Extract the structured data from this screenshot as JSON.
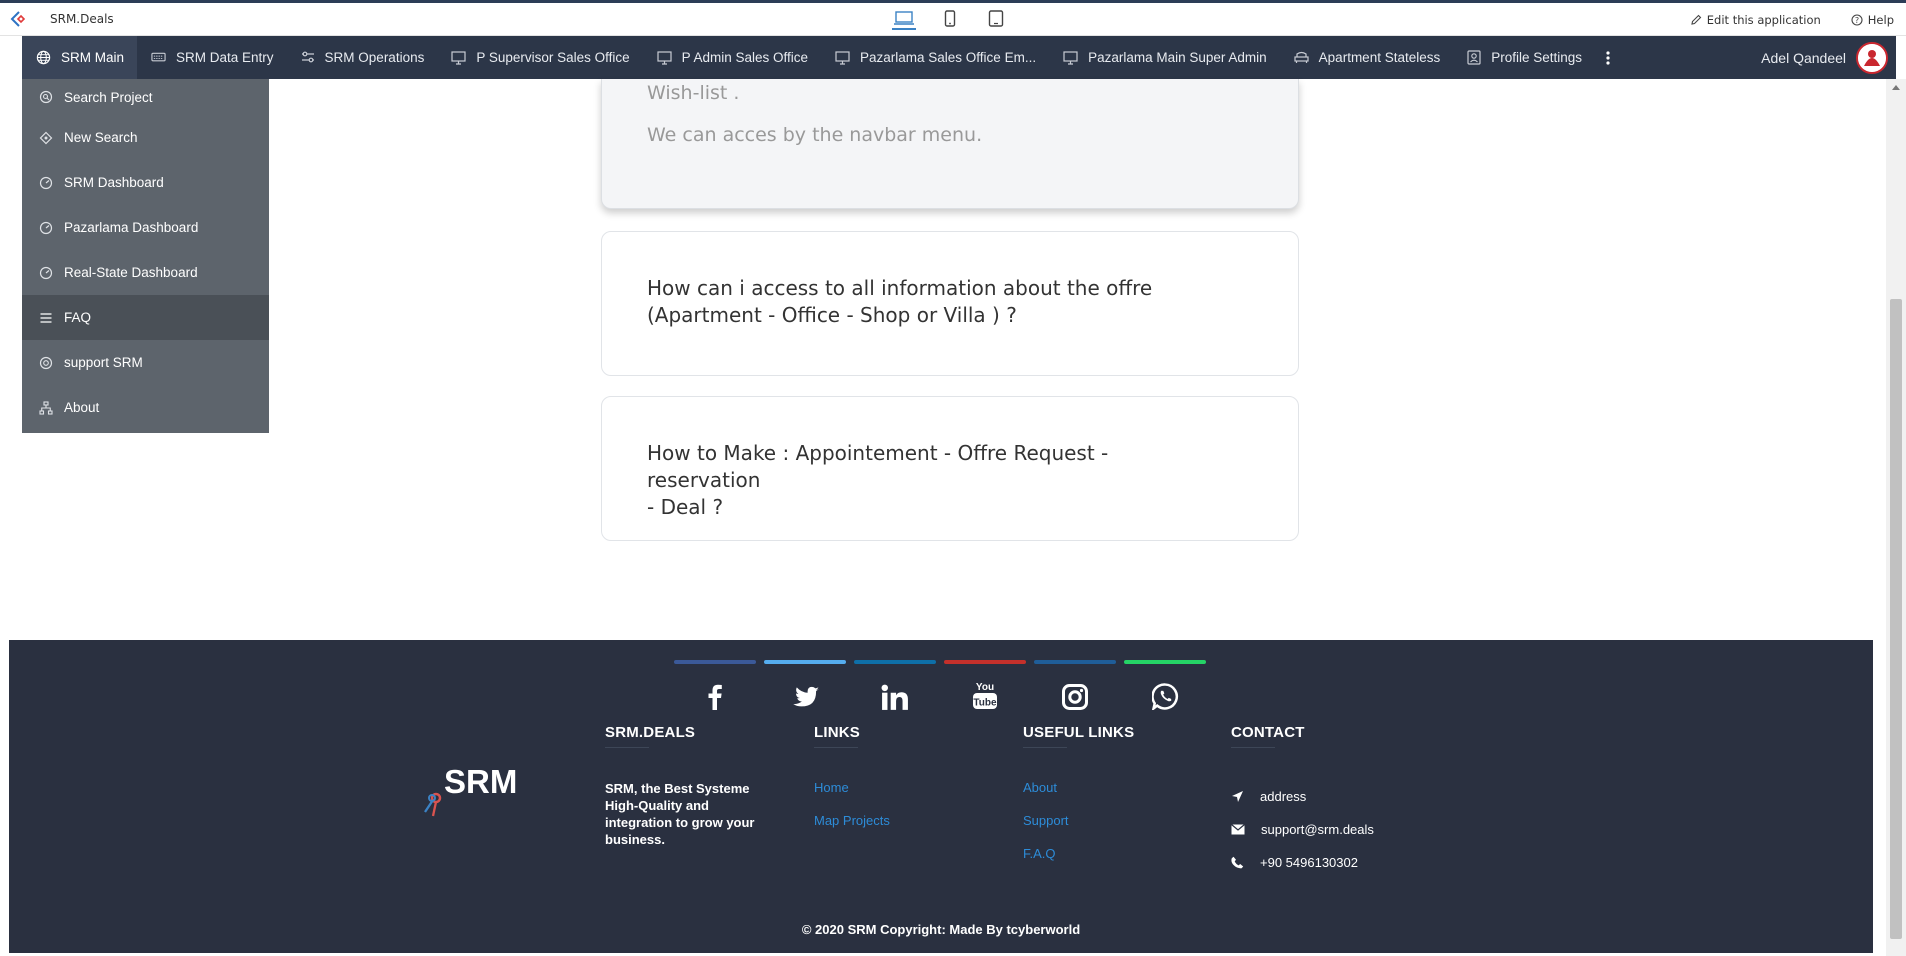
{
  "appbar": {
    "title": "SRM.Deals",
    "edit_label": "Edit this application",
    "help_label": "Help"
  },
  "navbar": {
    "items": [
      {
        "label": "SRM Main",
        "icon": "globe-icon"
      },
      {
        "label": "SRM Data Entry",
        "icon": "keyboard-icon"
      },
      {
        "label": "SRM Operations",
        "icon": "sliders-icon"
      },
      {
        "label": "P Supervisor Sales Office",
        "icon": "monitor-icon"
      },
      {
        "label": "P Admin Sales Office",
        "icon": "monitor-icon"
      },
      {
        "label": "Pazarlama Sales Office Em...",
        "icon": "monitor-icon"
      },
      {
        "label": "Pazarlama Main Super Admin",
        "icon": "monitor-icon"
      },
      {
        "label": "Apartment Stateless",
        "icon": "couch-icon"
      },
      {
        "label": "Profile Settings",
        "icon": "profile-icon"
      }
    ],
    "user_name": "Adel Qandeel"
  },
  "sidebar": {
    "items": [
      {
        "label": "Search Project"
      },
      {
        "label": "New Search"
      },
      {
        "label": "SRM Dashboard"
      },
      {
        "label": "Pazarlama Dashboard"
      },
      {
        "label": "Real-State Dashboard"
      },
      {
        "label": "FAQ"
      },
      {
        "label": "support SRM"
      },
      {
        "label": "About"
      }
    ]
  },
  "faq": {
    "open_answer_line1": "Wish-list .",
    "open_answer_line2": "We can acces by the navbar menu.",
    "q2_line1": "How can i access to all information about the offre",
    "q2_line2": "(Apartment - Office - Shop or Villa ) ?",
    "q3_line1": "How to Make : Appointement - Offre Request - reservation",
    "q3_line2": "- Deal ?"
  },
  "footer": {
    "social": [
      {
        "icon": "facebook-icon",
        "color": "#3b5998"
      },
      {
        "icon": "twitter-icon",
        "color": "#55acee"
      },
      {
        "icon": "linkedin-icon",
        "color": "#0e6fa8"
      },
      {
        "icon": "youtube-icon",
        "color": "#c4302b"
      },
      {
        "icon": "instagram-icon",
        "color": "#1f5d98"
      },
      {
        "icon": "whatsapp-icon",
        "color": "#25d366"
      }
    ],
    "logo_text": "SRM",
    "brand_heading": "SRM.DEALS",
    "brand_text": "SRM, the Best Systeme High-Quality and integration to grow your business.",
    "links_heading": "LINKS",
    "links": [
      "Home",
      "Map Projects"
    ],
    "useful_heading": "USEFUL LINKS",
    "useful_links": [
      "About",
      "Support",
      "F.A.Q"
    ],
    "contact_heading": "CONTACT",
    "contact": {
      "address": "address",
      "email": "support@srm.deals",
      "phone": "+90 5496130302"
    },
    "copyright": "© 2020 SRM Copyright: Made By tcyberworld"
  }
}
